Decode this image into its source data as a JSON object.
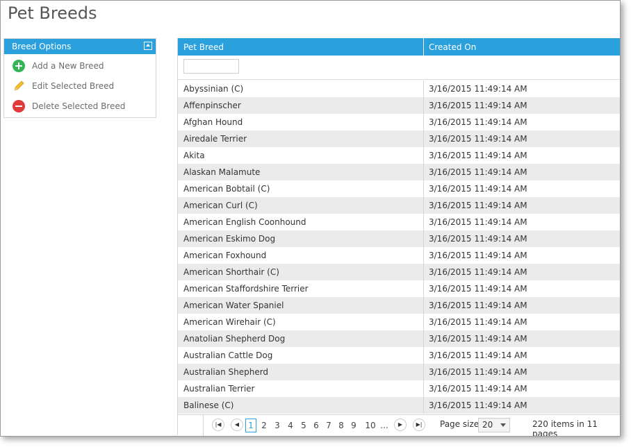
{
  "page": {
    "title": "Pet Breeds"
  },
  "sidebar": {
    "header": "Breed Options",
    "items": [
      {
        "label": "Add a New Breed",
        "icon": "add-icon"
      },
      {
        "label": "Edit Selected Breed",
        "icon": "pencil-icon"
      },
      {
        "label": "Delete Selected Breed",
        "icon": "delete-icon"
      }
    ]
  },
  "grid": {
    "columns": [
      "Pet Breed",
      "Created On"
    ],
    "filter_value": "",
    "rows": [
      [
        "Abyssinian (C)",
        "3/16/2015 11:49:14 AM"
      ],
      [
        "Affenpinscher",
        "3/16/2015 11:49:14 AM"
      ],
      [
        "Afghan Hound",
        "3/16/2015 11:49:14 AM"
      ],
      [
        "Airedale Terrier",
        "3/16/2015 11:49:14 AM"
      ],
      [
        "Akita",
        "3/16/2015 11:49:14 AM"
      ],
      [
        "Alaskan Malamute",
        "3/16/2015 11:49:14 AM"
      ],
      [
        "American Bobtail (C)",
        "3/16/2015 11:49:14 AM"
      ],
      [
        "American Curl (C)",
        "3/16/2015 11:49:14 AM"
      ],
      [
        "American English Coonhound",
        "3/16/2015 11:49:14 AM"
      ],
      [
        "American Eskimo Dog",
        "3/16/2015 11:49:14 AM"
      ],
      [
        "American Foxhound",
        "3/16/2015 11:49:14 AM"
      ],
      [
        "American Shorthair (C)",
        "3/16/2015 11:49:14 AM"
      ],
      [
        "American Staffordshire Terrier",
        "3/16/2015 11:49:14 AM"
      ],
      [
        "American Water Spaniel",
        "3/16/2015 11:49:14 AM"
      ],
      [
        "American Wirehair (C)",
        "3/16/2015 11:49:14 AM"
      ],
      [
        "Anatolian Shepherd Dog",
        "3/16/2015 11:49:14 AM"
      ],
      [
        "Australian Cattle Dog",
        "3/16/2015 11:49:14 AM"
      ],
      [
        "Australian Shepherd",
        "3/16/2015 11:49:14 AM"
      ],
      [
        "Australian Terrier",
        "3/16/2015 11:49:14 AM"
      ],
      [
        "Balinese (C)",
        "3/16/2015 11:49:14 AM"
      ]
    ]
  },
  "pager": {
    "pages": [
      "1",
      "2",
      "3",
      "4",
      "5",
      "6",
      "7",
      "8",
      "9",
      "10",
      "..."
    ],
    "current_page": "1",
    "page_size_label": "Page size:",
    "page_size": "20",
    "info": "220 items in 11 pages"
  },
  "colors": {
    "accent": "#2aa0dc",
    "alt_row": "#ebebeb"
  }
}
